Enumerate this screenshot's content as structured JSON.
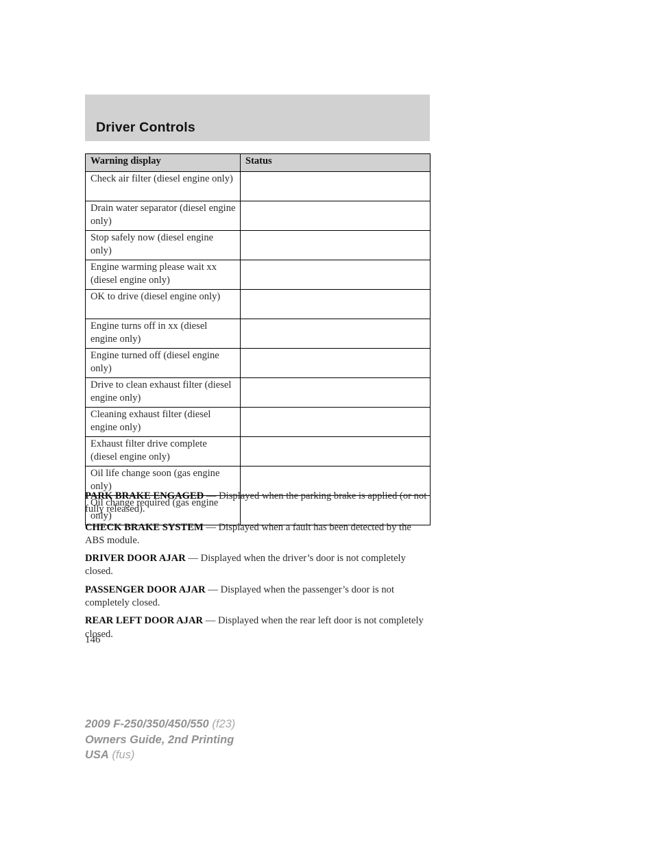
{
  "section": {
    "banner_title": "Driver Controls"
  },
  "table": {
    "columns": [
      "Warning display",
      "Status"
    ],
    "rows": [
      {
        "display": "Check air filter (diesel engine only)",
        "status": ""
      },
      {
        "display": "Drain water separator (diesel engine only)",
        "status": ""
      },
      {
        "display": "Stop safely now (diesel engine only)",
        "status": ""
      },
      {
        "display": "Engine warming please wait xx (diesel engine only)",
        "status": ""
      },
      {
        "display": "OK to drive (diesel engine only)",
        "status": ""
      },
      {
        "display": "Engine turns off in xx (diesel engine only)",
        "status": ""
      },
      {
        "display": "Engine turned off (diesel engine only)",
        "status": ""
      },
      {
        "display": "Drive to clean exhaust filter (diesel engine only)",
        "status": ""
      },
      {
        "display": "Cleaning exhaust filter (diesel engine only)",
        "status": ""
      },
      {
        "display": "Exhaust filter drive complete (diesel engine only)",
        "status": ""
      },
      {
        "display": "Oil life change soon (gas engine only)",
        "status": ""
      },
      {
        "display": "Oil change required (gas engine only)",
        "status": ""
      }
    ]
  },
  "definitions": [
    {
      "term": "PARK BRAKE ENGAGED",
      "description": " — Displayed when the parking brake is applied (or not fully released)."
    },
    {
      "term": "CHECK BRAKE SYSTEM",
      "description": " — Displayed when a fault has been detected by the ABS module."
    },
    {
      "term": "DRIVER DOOR AJAR",
      "description": " — Displayed when the driver’s door is not completely closed."
    },
    {
      "term": "PASSENGER DOOR AJAR",
      "description": " — Displayed when the passenger’s door is not completely closed."
    },
    {
      "term": "REAR LEFT DOOR AJAR",
      "description": " — Displayed when the rear left door is not completely closed."
    }
  ],
  "page_number": "146",
  "footer": {
    "line1_strong": "2009 F-250/350/450/550",
    "line1_light": " (f23)",
    "line2_strong": "Owners Guide, 2nd Printing",
    "line3_strong": "USA",
    "line3_light": " (fus)"
  },
  "colors": {
    "banner_gray": "#d1d1d1",
    "footer_gray": "#9a9a9a",
    "text": "#2b2b2b",
    "rule": "#000000"
  }
}
